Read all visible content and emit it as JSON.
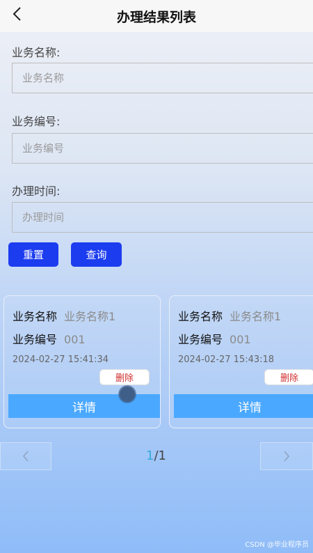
{
  "header": {
    "title": "办理结果列表"
  },
  "form": {
    "name_label": "业务名称:",
    "name_placeholder": "业务名称",
    "code_label": "业务编号:",
    "code_placeholder": "业务编号",
    "time_label": "办理时间:",
    "time_placeholder": "办理时间",
    "reset_label": "重置",
    "search_label": "查询"
  },
  "cards": [
    {
      "name_key": "业务名称",
      "name_value": "业务名称1",
      "code_key": "业务编号",
      "code_value": "001",
      "time": "2024-02-27 15:41:34",
      "delete_label": "删除",
      "detail_label": "详情"
    },
    {
      "name_key": "业务名称",
      "name_value": "业务名称1",
      "code_key": "业务编号",
      "code_value": "001",
      "time": "2024-02-27 15:43:18",
      "delete_label": "删除",
      "detail_label": "详情"
    }
  ],
  "pager": {
    "current": "1",
    "separator": "/",
    "total": "1"
  },
  "watermark": "CSDN @毕业程序员",
  "colors": {
    "primary_button": "#1c3cf0",
    "detail_bar": "#4aa8ff",
    "delete_text": "#d0302f",
    "current_page": "#36a8d8"
  },
  "icons": {
    "back": "chevron-left-icon",
    "prev": "chevron-left-icon",
    "next": "chevron-right-icon"
  }
}
